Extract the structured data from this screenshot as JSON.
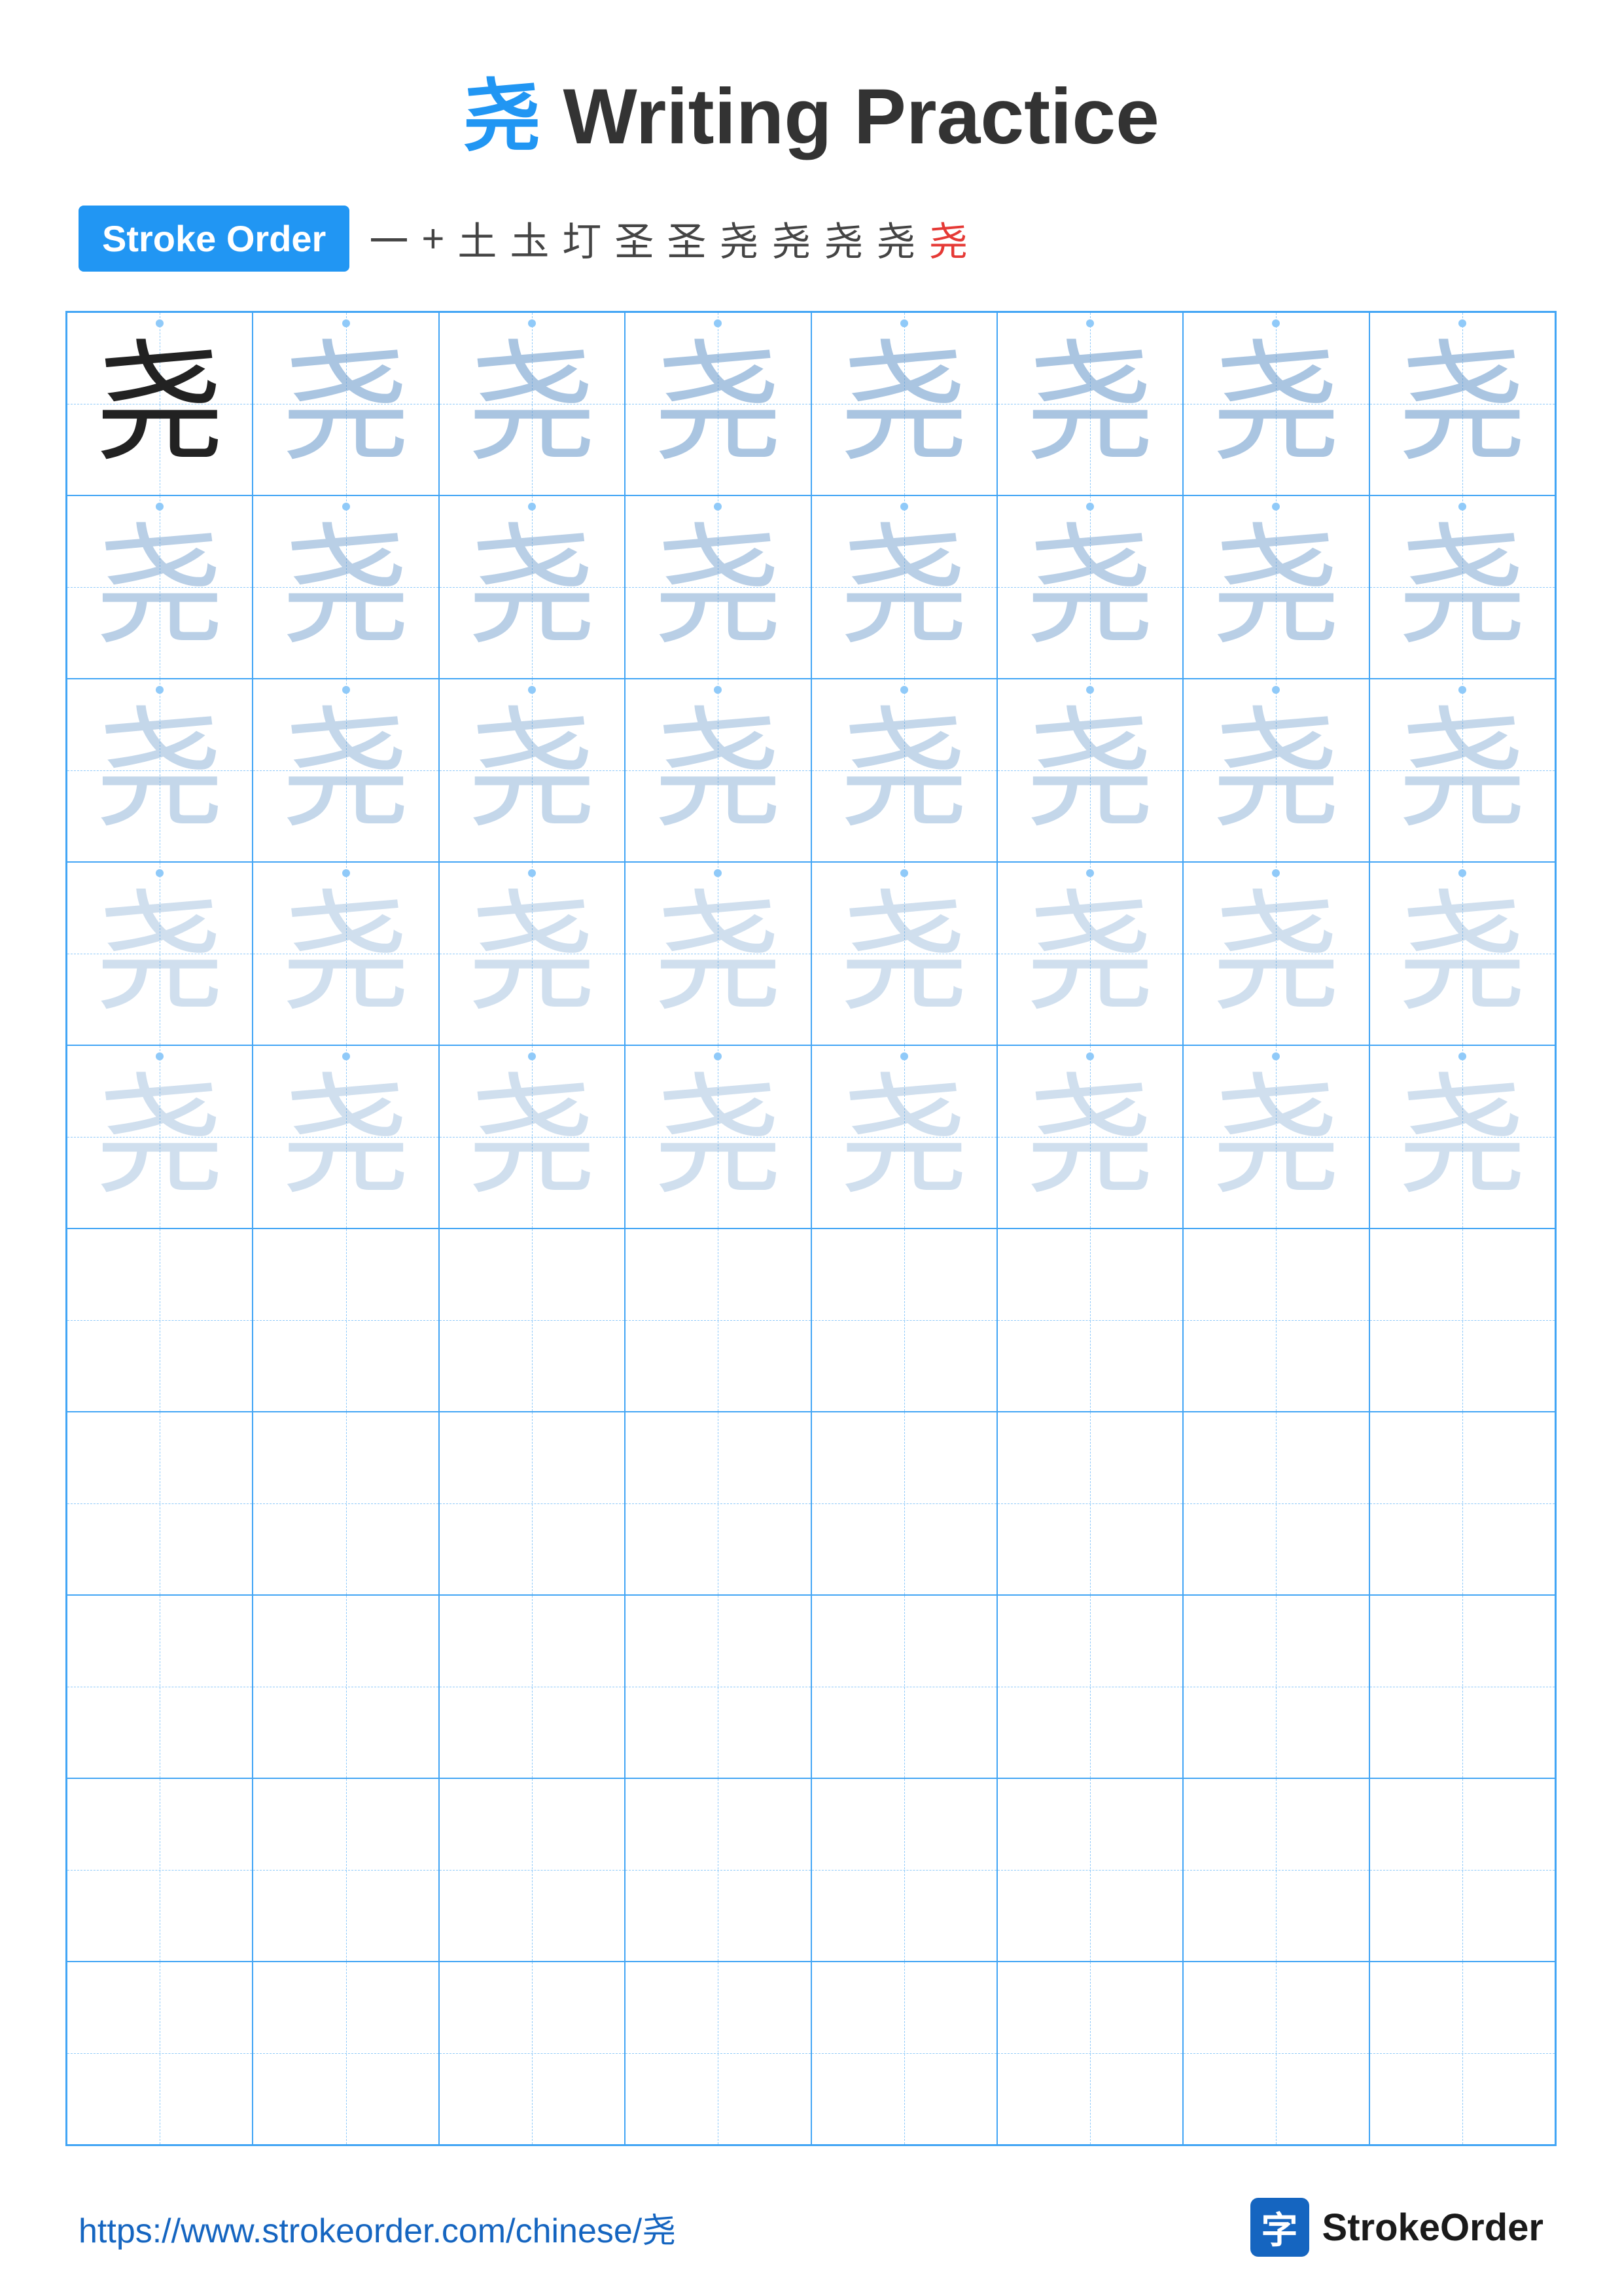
{
  "title": {
    "char": "尧",
    "text": " Writing Practice"
  },
  "stroke_order": {
    "badge_label": "Stroke Order",
    "sequence": [
      "一",
      "+",
      "土",
      "圡",
      "圢",
      "圣",
      "圣",
      "尧",
      "尧",
      "尧",
      "尧",
      "尧"
    ]
  },
  "grid": {
    "rows": 10,
    "cols": 8,
    "character": "尧",
    "fade_rows": [
      [
        0,
        1,
        1,
        1,
        1,
        1,
        1,
        1
      ],
      [
        2,
        2,
        2,
        2,
        2,
        2,
        2,
        2
      ],
      [
        3,
        3,
        3,
        3,
        3,
        3,
        3,
        3
      ],
      [
        4,
        4,
        4,
        4,
        4,
        4,
        4,
        4
      ],
      [
        5,
        5,
        5,
        5,
        5,
        5,
        5,
        5
      ],
      [
        6,
        6,
        6,
        6,
        6,
        6,
        6,
        6
      ],
      [
        6,
        6,
        6,
        6,
        6,
        6,
        6,
        6
      ],
      [
        6,
        6,
        6,
        6,
        6,
        6,
        6,
        6
      ],
      [
        6,
        6,
        6,
        6,
        6,
        6,
        6,
        6
      ],
      [
        6,
        6,
        6,
        6,
        6,
        6,
        6,
        6
      ]
    ]
  },
  "footer": {
    "url": "https://www.strokeorder.com/chinese/尧",
    "logo_icon": "字",
    "logo_text": "StrokeOrder"
  }
}
